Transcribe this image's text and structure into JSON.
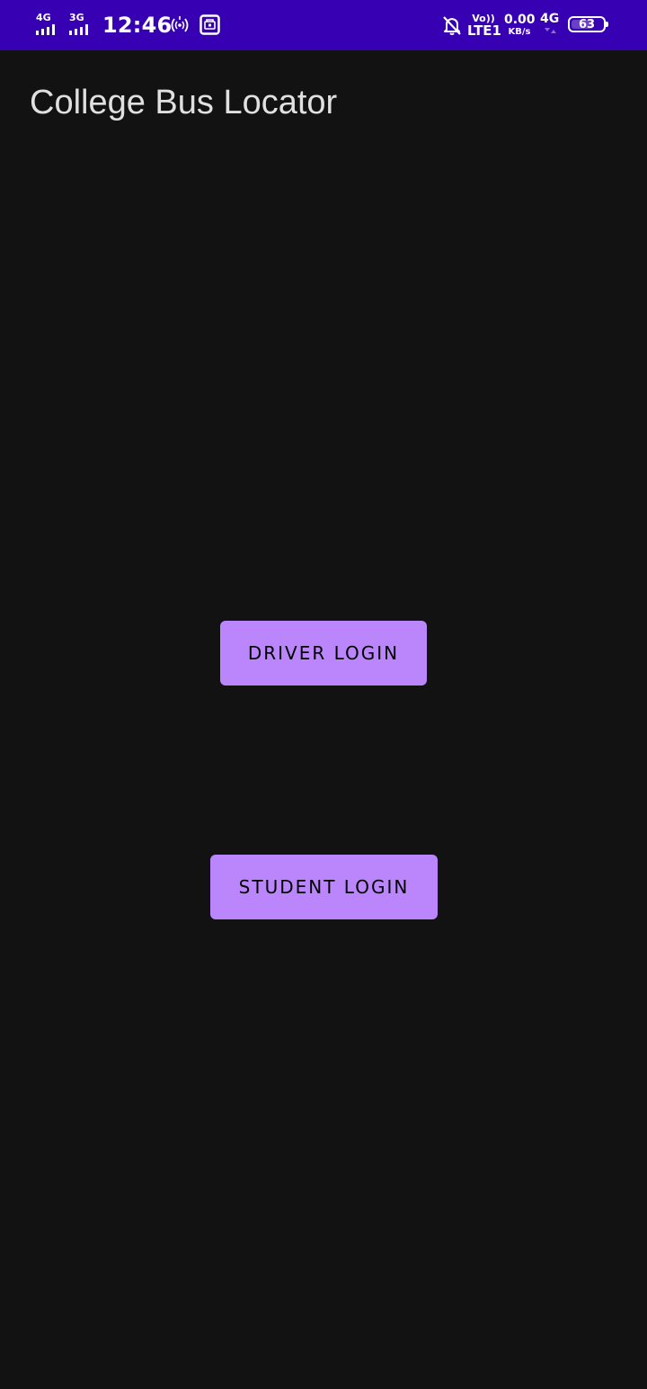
{
  "status_bar": {
    "sim1_network": "4G",
    "sim2_network": "3G",
    "time": "12:46",
    "hotspot_icon": "hotspot-icon",
    "app_notification_icon": "app-notification-icon",
    "mute_icon": "bell-off-icon",
    "volte_top": "Vo))",
    "volte_bottom": "LTE1",
    "speed_value": "0.00",
    "speed_unit": "KB/s",
    "data_network": "4G",
    "battery_level": "63",
    "background_color": "#3700B3"
  },
  "app": {
    "title": "College Bus Locator",
    "background_color": "#121212",
    "accent_color": "#BB86FC"
  },
  "buttons": {
    "driver_login": "DRIVER LOGIN",
    "student_login": "STUDENT LOGIN"
  }
}
